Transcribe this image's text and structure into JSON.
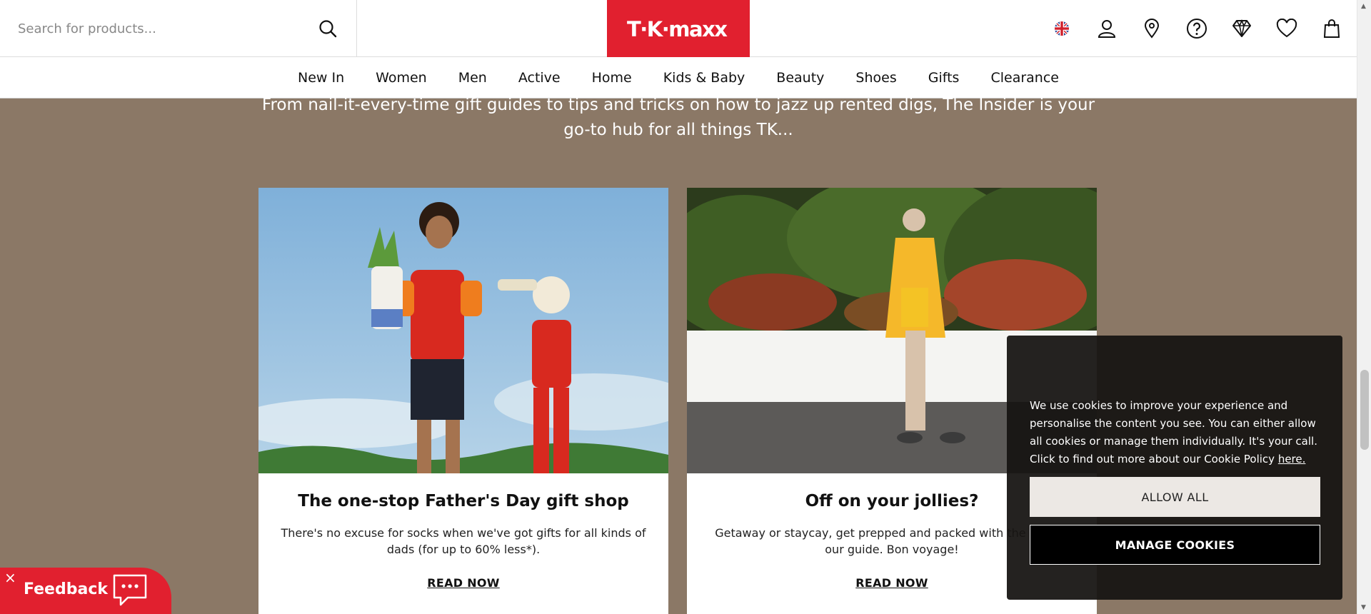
{
  "search": {
    "placeholder": "Search for products..."
  },
  "brand": {
    "logo_text": "TK maxx",
    "color": "#e1202f"
  },
  "header_icons": [
    "uk-flag-icon",
    "account-icon",
    "store-locator-icon",
    "help-icon",
    "gold-label-icon",
    "wishlist-icon",
    "bag-icon"
  ],
  "nav": {
    "items": [
      {
        "label": "New In"
      },
      {
        "label": "Women"
      },
      {
        "label": "Men"
      },
      {
        "label": "Active"
      },
      {
        "label": "Home"
      },
      {
        "label": "Kids & Baby"
      },
      {
        "label": "Beauty"
      },
      {
        "label": "Shoes"
      },
      {
        "label": "Gifts"
      },
      {
        "label": "Clearance"
      }
    ]
  },
  "intro": {
    "text": "From nail-it-every-time gift guides to tips and tricks on how to jazz up rented digs, The Insider is your go-to hub for all things TK..."
  },
  "cards": [
    {
      "title": "The one-stop Father's Day gift shop",
      "description": "There's no excuse for socks when we've got gifts for all kinds of dads (for up to 60% less*).",
      "link": "READ NOW"
    },
    {
      "title": "Off on your jollies?",
      "description": "Getaway or staycay, get prepped and packed with the help of our guide. Bon voyage!",
      "link": "READ NOW"
    }
  ],
  "cookie": {
    "text": "We use cookies to improve your experience and personalise the content you see. You can either allow all cookies or manage them individually. It's your call. Click to find out more about our Cookie Policy",
    "link_text": "here.",
    "allow_all": "ALLOW ALL",
    "manage": "MANAGE COOKIES"
  },
  "feedback": {
    "close": "×",
    "label": "Feedback"
  },
  "colors": {
    "page_background": "#8b7866",
    "accent_red": "#e1202f"
  }
}
